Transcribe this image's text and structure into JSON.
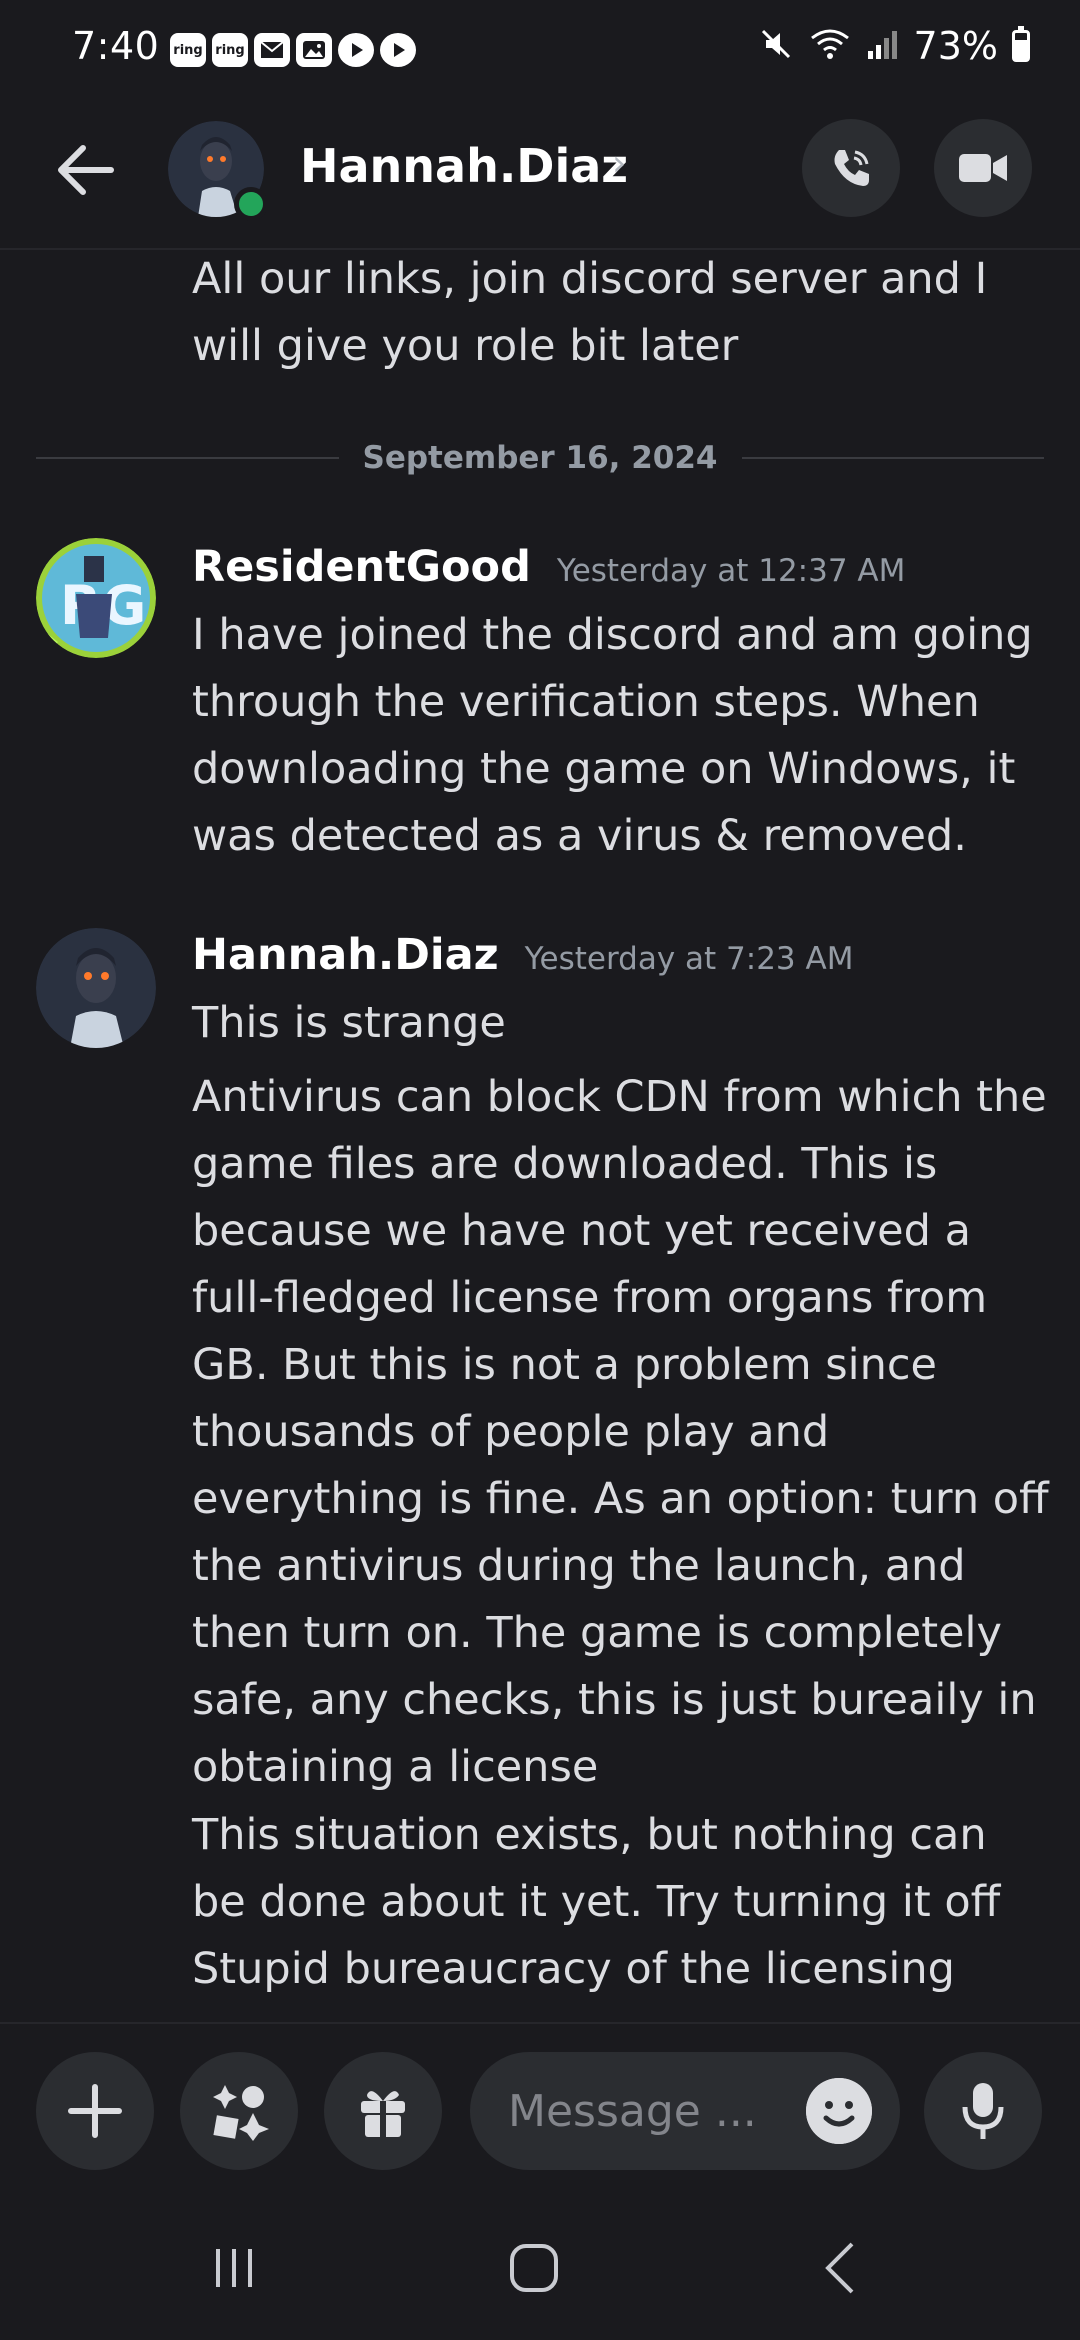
{
  "status_bar": {
    "time": "7:40",
    "notifications": [
      "ring",
      "ring"
    ],
    "battery": "73%",
    "battery_level": 0.73
  },
  "header": {
    "contact_name": "Hannah.Diaz",
    "chevron": "›",
    "status_color": "#23a55a"
  },
  "messages": {
    "previous_tail": "All our links, join discord server and I will give you role bit later",
    "date_divider": "September 16, 2024",
    "groups": [
      {
        "author": "ResidentGood",
        "timestamp": "Yesterday at 12:37 AM",
        "lines": [
          "I have joined the discord and am going through the verification steps. When downloading the game on Windows, it was detected as a virus & removed."
        ]
      },
      {
        "author": "Hannah.Diaz",
        "timestamp": "Yesterday at 7:23 AM",
        "lines": [
          "This is strange",
          "Antivirus can block CDN from which the game files are downloaded. This is because we have not yet received a full-fledged license from organs from GB. But this is not a problem since thousands of people play and everything is fine. As an option: turn off the antivirus during the launch, and then turn on. The game is completely safe, any checks, this is just bureaily in obtaining a license",
          "This situation exists, but nothing can be done about it yet. Try turning it off",
          "Stupid bureaucracy of the licensing"
        ]
      }
    ]
  },
  "input": {
    "placeholder": "Message ..."
  },
  "colors": {
    "background": "#1a1a1e",
    "surface": "#2b2d31",
    "text": "#dcdde1",
    "muted": "#949ba4",
    "online": "#23a55a"
  }
}
